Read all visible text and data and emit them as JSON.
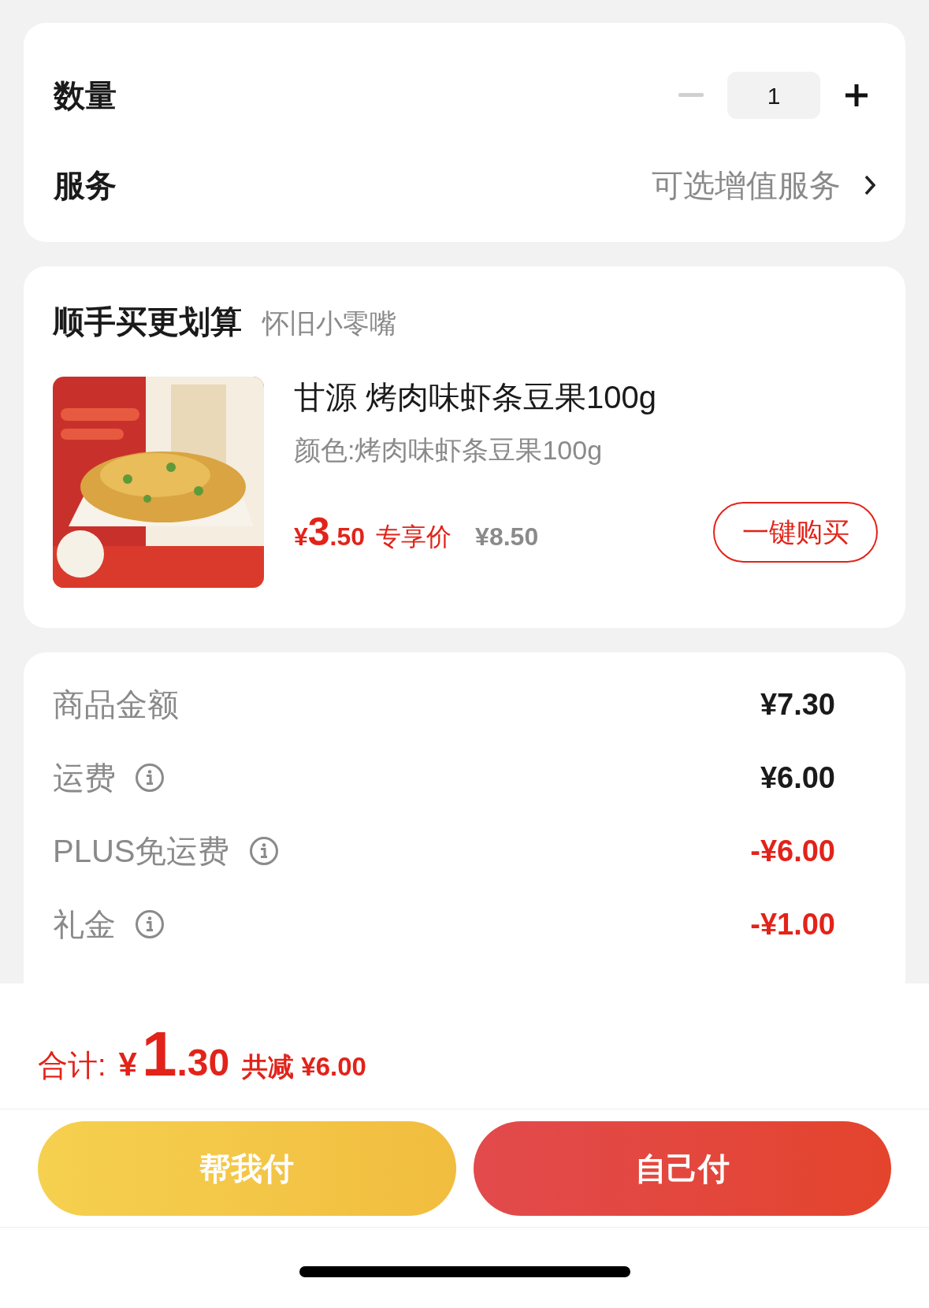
{
  "quantity": {
    "label": "数量",
    "value": "1",
    "decrease_disabled": true
  },
  "service": {
    "label": "服务",
    "value": "可选增值服务"
  },
  "bundle": {
    "title": "顺手买更划算",
    "subtitle": "怀旧小零嘴",
    "product": {
      "name": "甘源 烤肉味虾条豆果100g",
      "variant": "颜色:烤肉味虾条豆果100g",
      "currency": "¥",
      "integer": "3",
      "decimal": ".50",
      "price_tag": "专享价",
      "original_price": "¥8.50",
      "button": "一键购买"
    }
  },
  "summary": [
    {
      "label": "商品金额",
      "info": false,
      "value": "¥7.30",
      "discount": false
    },
    {
      "label": "运费",
      "info": true,
      "value": "¥6.00",
      "discount": false
    },
    {
      "label": "PLUS免运费",
      "info": true,
      "value": "-¥6.00",
      "discount": true
    },
    {
      "label": "礼金",
      "info": true,
      "value": "-¥1.00",
      "discount": true
    }
  ],
  "total": {
    "label": "合计:",
    "currency": "¥",
    "integer": "1",
    "decimal": ".30",
    "saving": "共减 ¥6.00"
  },
  "buttons": [
    {
      "label": "帮我付",
      "kind": "friend"
    },
    {
      "label": "自己付",
      "kind": "self"
    }
  ]
}
